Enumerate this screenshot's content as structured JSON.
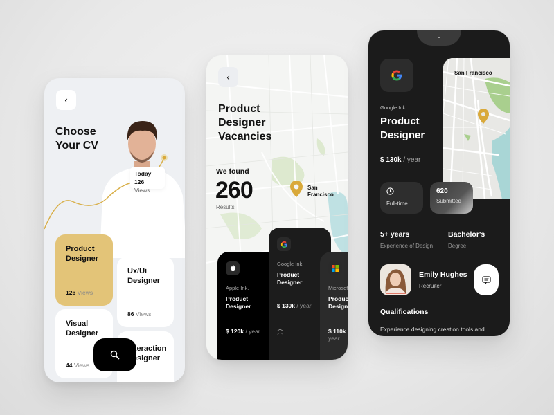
{
  "colors": {
    "accent_gold": "#e3c478",
    "pin_gold": "#d9a93a",
    "dark": "#1b1b1b",
    "black": "#000000",
    "light_bg": "#eef0f3"
  },
  "screen_cv": {
    "back_icon": "chevron-left-icon",
    "back_glyph": "‹",
    "title": "Choose Your CV",
    "stat_card": {
      "label": "Today",
      "count": "126",
      "unit": "Views"
    },
    "cards": [
      {
        "title": "Product Designer",
        "count": "126",
        "unit": "Views",
        "selected": true
      },
      {
        "title": "Ux/Ui Designer",
        "count": "86",
        "unit": "Views",
        "selected": false
      },
      {
        "title": "Visual Designer",
        "count": "44",
        "unit": "Views",
        "selected": false
      },
      {
        "title": "Interaction Designer",
        "count": "",
        "unit": "",
        "selected": false
      }
    ],
    "search_icon": "search-icon"
  },
  "screen_vacancies": {
    "back_glyph": "‹",
    "title": "Product Designer Vacancies",
    "found_label": "We found",
    "found_count": "260",
    "found_sub": "Results",
    "map_label": "San Francisco",
    "jobs": [
      {
        "company": "Apple Ink.",
        "role": "Product Designer",
        "salary": "$ 120k",
        "period": "/ year",
        "logo": "apple-icon"
      },
      {
        "company": "Google Ink.",
        "role": "Product Designer",
        "salary": "$ 130k",
        "period": "/ year",
        "logo": "google-icon"
      },
      {
        "company": "Microsoft",
        "role": "Product Designer",
        "salary": "$ 110k",
        "period": "/ year",
        "logo": "microsoft-icon"
      }
    ],
    "expand_glyph": "︿"
  },
  "screen_detail": {
    "collapse_glyph": "⌄",
    "company": "Google Ink.",
    "title": "Product Designer",
    "salary": "$ 130k",
    "period": "/ year",
    "map_label": "San Francisco",
    "stats": [
      {
        "icon": "clock-icon",
        "label": "Full-time"
      },
      {
        "value": "620",
        "label": "Submitted"
      }
    ],
    "info": [
      {
        "heading": "5+ years",
        "sub": "Experience of Design"
      },
      {
        "heading": "Bachelor's",
        "sub": "Degree"
      }
    ],
    "recruiter": {
      "name": "Emily Hughes",
      "role": "Recruiter"
    },
    "qualifications_title": "Qualifications",
    "qualifications_text": "Experience designing creation tools and"
  }
}
